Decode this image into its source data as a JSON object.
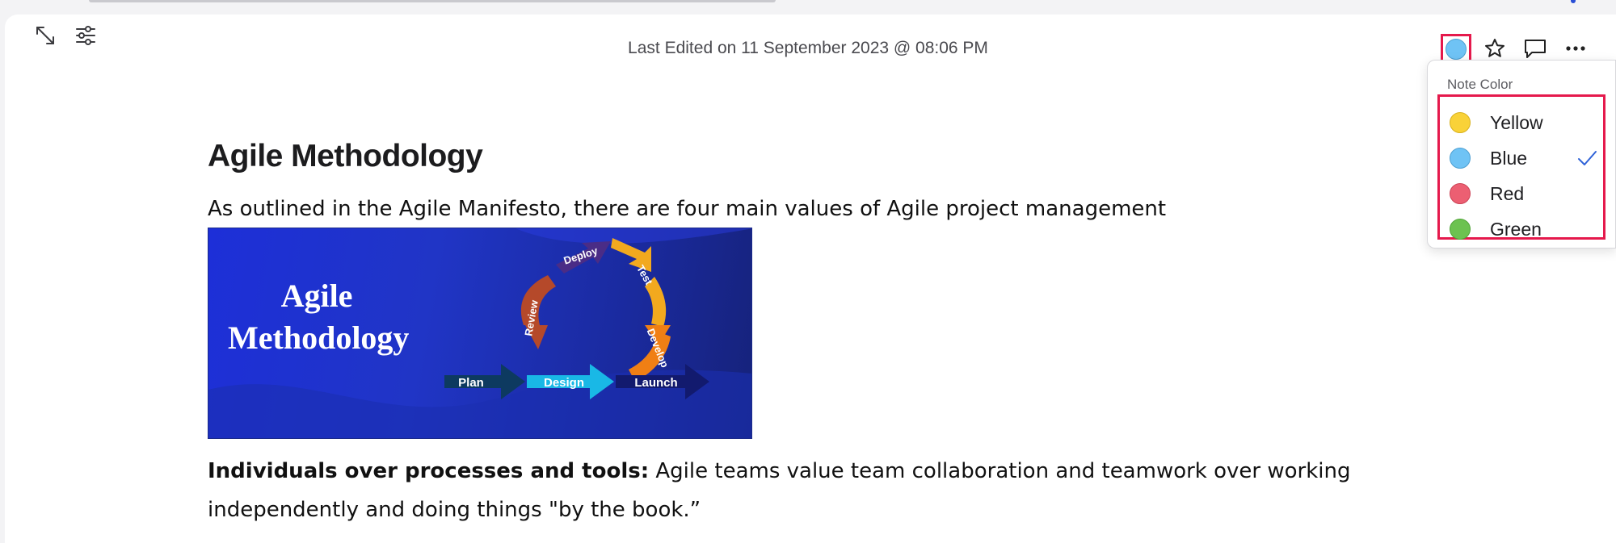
{
  "header": {
    "last_edited": "Last Edited on 11 September 2023 @ 08:06 PM"
  },
  "toolbar": {
    "current_color": "#6fc3f5"
  },
  "color_menu": {
    "title": "Note Color",
    "options": [
      {
        "label": "Yellow",
        "color": "#f9d238",
        "selected": false
      },
      {
        "label": "Blue",
        "color": "#6fc3f5",
        "selected": true
      },
      {
        "label": "Red",
        "color": "#ec5f72",
        "selected": false
      },
      {
        "label": "Green",
        "color": "#6cc250",
        "selected": false
      }
    ]
  },
  "document": {
    "heading": "Agile Methodology",
    "intro": "As outlined in the Agile Manifesto, there are four main values of Agile project management",
    "image": {
      "title_line1": "Agile",
      "title_line2": "Methodology",
      "steps": [
        "Plan",
        "Design",
        "Launch",
        "Develop",
        "Test",
        "Deploy",
        "Review"
      ]
    },
    "paragraph_bold": "Individuals over processes and tools:",
    "paragraph_text": " Agile teams value team collaboration and teamwork over working independently and doing things \"by the book.”"
  }
}
